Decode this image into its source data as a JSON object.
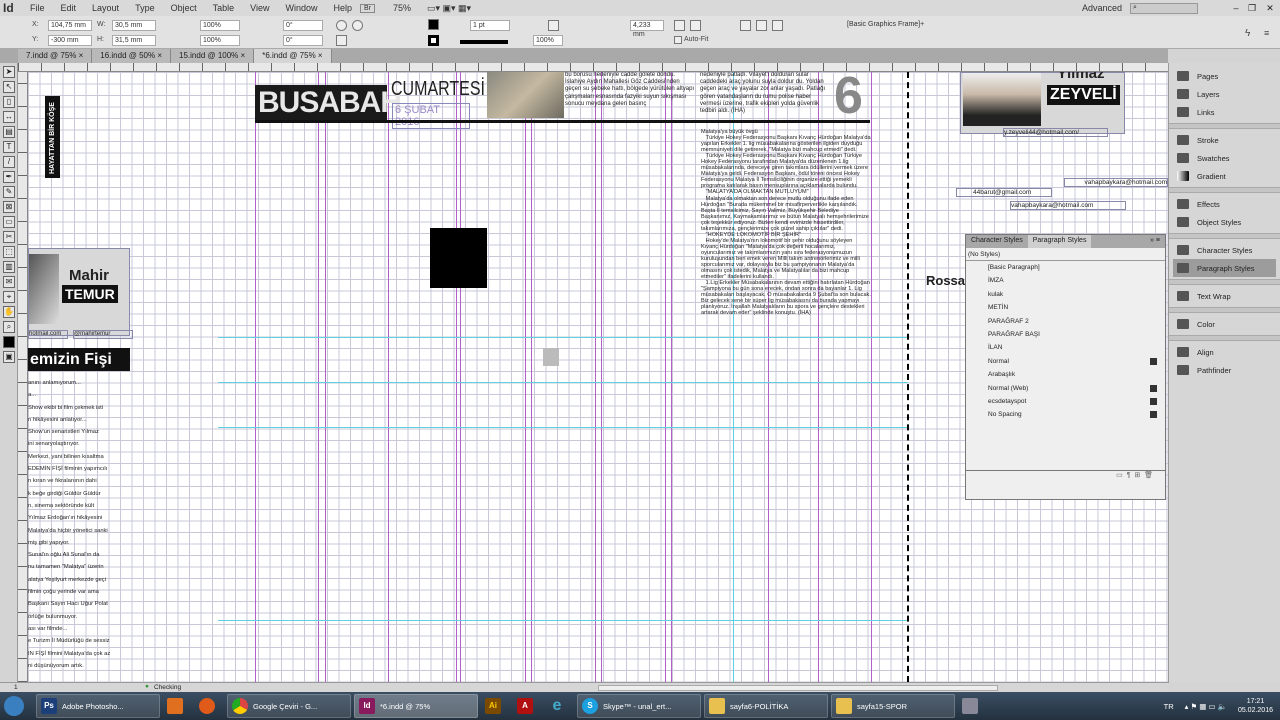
{
  "app": {
    "logo": "Id",
    "menu": [
      "File",
      "Edit",
      "Layout",
      "Type",
      "Object",
      "Table",
      "View",
      "Window",
      "Help"
    ],
    "bridge": "Br",
    "zoom": "75%",
    "workspace": "Advanced",
    "search_placeholder": ""
  },
  "control": {
    "x": "104,75 mm",
    "y": "-300 mm",
    "w": "30,5 mm",
    "h": "31,5 mm",
    "scale_x": "100%",
    "scale_y": "100%",
    "rotate": "0°",
    "shear": "0°",
    "stroke_weight": "1 pt",
    "opacity": "100%",
    "offset": "4,233 mm",
    "auto_fit": "Auto-Fit",
    "object_style": "[Basic Graphics Frame]+"
  },
  "tabs": [
    "7.indd @ 75%",
    "16.indd @ 50%",
    "15.indd @ 100%",
    "*6.indd @ 75%"
  ],
  "page": {
    "masthead": "BUSABAH",
    "day": "CUMARTESİ",
    "date": "6 ŞUBAT 2016",
    "page_number": "6",
    "top_col1": "bu borusu nedeniyle cadde gölete döndü. İslahiye Aydın Mahallesi Göz Caddesi'nden geçen su şebeke hattı, bölgede yürütülen altyapı çalışmaları esnasında fazyiki suyun sıkışması sonucu meydana gelen basınç",
    "top_col2": "nedeniyle patladı. Vilayet'i dolduran sular caddedeki araç yolunu suyla doldur du. Yoldan geçen araç ve yayalar zor anlar yaşadı. Patlağı gören vatandaşların du rumu polise haber vermesi üzerine, trafik ekipleri yolda güvenlik tedbiri aldı. (İHA)",
    "article": "Malatya'ya büyük övgü\n   Türkiye Hokey Federasyonu Başkanı Kıvanç Hürdoğan Malatya'da yapılan Erkekler 1. lig müsabakalarına gösterilen ilgiden duyduğu memnuniyeti dile getirerek, \"Malatya bizi mahcup etmedi\" dedi.\n   Türkiye Hokey Federasyonu Başkanı Kıvanç Hürdoğan Türkiye Hokey Federasyonu tarafından Malatya'da düzenlenen 1.lig müsabakalarında, dereceye giren takımlara ödüllerini vermek üzere Malatya'ya geldi. Federasyon Başkanı, ödül töreni öncesi Hokey Federasyonu Malatya İl Temsilciliğinin organize ettiği yemekli programa katılarak basın mensuplarına açıklamalarda bulundu.\n   \"MALATYA'DA OLMAKTAN MUTLUYUM\"\n   Malatya'da olmaktan son derece mutlu olduğunu ifade eden Hürdoğan \"Burada mükemmel bir misafirperverlikle karşılandık. Başta İl temsilcimiz, Sayın Valimiz, Büyükşehir Belediye Başkanımız, Kaymakamlarımız ve bütün Malatyalı hemşehrilerimize çok teşekkür ediyoruz. Bizleri kendi evimizde hissettirdiler, takımlarımıza, gençlerimize çok güzel sahip çıktılar\" dedi.\n   \"HOKEYDE LOKOMOTİF BİR ŞEHİR\"\n   Hokey'de Malatya'nın lokomotif bir şehir olduğunu söyleyen Kıvanç Hürdoğan \"Malatya'da çok değerli hocalarımız, oyuncularımız ve takımlarımızın yanı sıra federasyonumuzun kuruluşundan beri emek veren Milli takım antrenörlerimiz ve milli sporcularımız var, dolayısıyla biz bu şampiyonanın Malatya'da olmasını çok istedik, Malatya ve Malatyalılar da bizi mahcup etmediler\" ifadelerini kullandı.\n   1.Lig Erkekler Müsabakalarının devam ettiğini hatırlatan Hürdoğan \"Şampiyona bu gün sona erecek, ondan sonra da bayanlar 1. Lig müsabakaları başlayacak. O müsabakalarda 9 Şubat'ta son bulacak. Biz gelecek sene bir süper lig müsabakasını da burada yapmayı planlıyoruz. İnşallah Malatyalıların bu spora ve gençlere destekleri artarak devam eder\" şeklinde konuştu. (İHA)",
    "vertical_label": "HAYATTAN BİR KÖŞE",
    "author_left_first": "Mahir",
    "author_left_last": "TEMUR",
    "author_left_email": "hotmail.com",
    "author_left_twitter": "@mahirtemur",
    "left_title": "emizin Fişi",
    "left_text": [
      "anını anlamıyorum...",
      "a...",
      "Show ekibi bi film çekmek isti",
      "n hikâyesini anlatıyor...",
      "Show'un senaristleri Yılmaz",
      "ini senaryolaştırıyor.",
      "Merkezi, yani bilinen kısaltma",
      "EDEMİN FİŞİ filminin yapımcılı",
      "n kıran ve fıkralarıının dahi",
      "k beğe girdiği Güldür Güldür",
      "n, sinema sektöründe kült",
      "Yılmaz Erdoğan'ın hikâyesini",
      "Malatya'da hiçbir yönetici sanki",
      "miş gibi yapıyor.",
      "Sunal'ın oğlu Ali Sunal'ın da",
      "nu tamamen \"Malatya\" üzerin",
      "alatya Yeşilyurt merkezde geçi",
      "filmin çoğu yerinde var ama",
      "Başkanı Sayın Hacı Uğur Polat",
      "örlüğe bulunmuyor.",
      "ası var filmde...",
      "e Turizm İl Müdürlüğü de sessiz",
      "IN FİŞİ filmini Malatya'da çok az",
      "ni düşünüyorum artık."
    ],
    "author_right_first": "Yılmaz",
    "author_right_last": "ZEYVELİ",
    "author_right_email": "y.zeyveli44@hotmail.com/",
    "emails": [
      "vahapbaykara@hotmail.com",
      "44barut@gmail.com",
      "vahapbaykara@hotmail.com"
    ],
    "partial_name": "Rossat"
  },
  "right_panel": {
    "groups": [
      [
        "Pages",
        "Layers",
        "Links"
      ],
      [
        "Stroke",
        "Swatches",
        "Gradient"
      ],
      [
        "Effects",
        "Object Styles"
      ],
      [
        "Character Styles",
        "Paragraph Styles"
      ],
      [
        "Text Wrap"
      ],
      [
        "Color"
      ],
      [
        "Align",
        "Pathfinder"
      ]
    ],
    "selected": "Paragraph Styles"
  },
  "paragraph_styles": {
    "tabs": [
      "Character Styles",
      "Paragraph Styles"
    ],
    "current": "(No Styles)",
    "items": [
      {
        "name": "[Basic Paragraph]",
        "imported": false
      },
      {
        "name": "İMZA",
        "imported": false
      },
      {
        "name": "kulak",
        "imported": false
      },
      {
        "name": "METİN",
        "imported": false
      },
      {
        "name": "PARAĞRAF 2",
        "imported": false
      },
      {
        "name": "PARAĞRAF BAŞI",
        "imported": false
      },
      {
        "name": "İLAN",
        "imported": false
      },
      {
        "name": "Normal",
        "imported": true
      },
      {
        "name": "Arabaşlık",
        "imported": false
      },
      {
        "name": "Normal (Web)",
        "imported": true
      },
      {
        "name": "ecsdetayspot",
        "imported": true
      },
      {
        "name": "No Spacing",
        "imported": true
      }
    ]
  },
  "status": {
    "page": "1",
    "preflight": "Checking"
  },
  "taskbar": {
    "items": [
      {
        "label": "Adobe Photosho...",
        "icon": "Ps",
        "color": "#1c3f7a"
      },
      {
        "label": "Google Çeviri - G...",
        "icon": "G",
        "color": "#d44"
      },
      {
        "label": "*6.indd @ 75%",
        "icon": "Id",
        "color": "#8a1a5e"
      },
      {
        "label": "Skype™ - unal_ert...",
        "icon": "S",
        "color": "#1ba0e0"
      },
      {
        "label": "sayfa6-POLİTİKA",
        "icon": "F",
        "color": "#e8c050"
      },
      {
        "label": "sayfa15-SPOR",
        "icon": "F",
        "color": "#e8c050"
      }
    ],
    "language": "TR",
    "time": "17:21",
    "date": "05.02.2016"
  }
}
